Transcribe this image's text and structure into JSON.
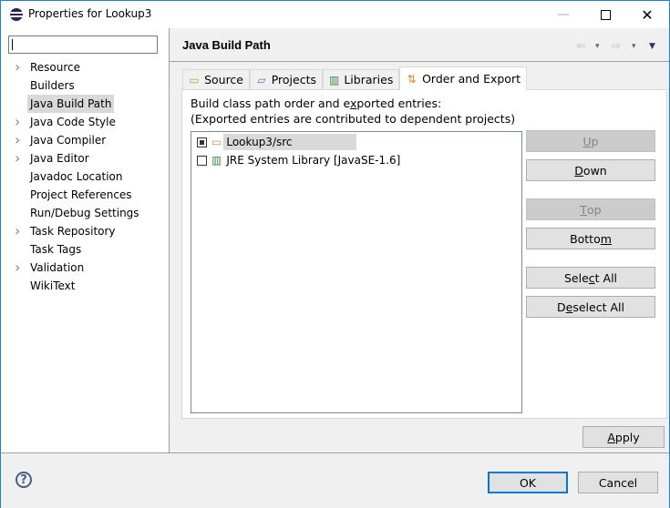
{
  "window": {
    "title": "Properties for Lookup3",
    "controls": {
      "minimize": "—",
      "close": "✕"
    }
  },
  "sidebar": {
    "filter_value": "",
    "items": [
      {
        "label": "Resource",
        "expandable": true,
        "selected": false
      },
      {
        "label": "Builders",
        "expandable": false,
        "selected": false
      },
      {
        "label": "Java Build Path",
        "expandable": false,
        "selected": true
      },
      {
        "label": "Java Code Style",
        "expandable": true,
        "selected": false
      },
      {
        "label": "Java Compiler",
        "expandable": true,
        "selected": false
      },
      {
        "label": "Java Editor",
        "expandable": true,
        "selected": false
      },
      {
        "label": "Javadoc Location",
        "expandable": false,
        "selected": false
      },
      {
        "label": "Project References",
        "expandable": false,
        "selected": false
      },
      {
        "label": "Run/Debug Settings",
        "expandable": false,
        "selected": false
      },
      {
        "label": "Task Repository",
        "expandable": true,
        "selected": false
      },
      {
        "label": "Task Tags",
        "expandable": false,
        "selected": false
      },
      {
        "label": "Validation",
        "expandable": true,
        "selected": false
      },
      {
        "label": "WikiText",
        "expandable": false,
        "selected": false
      }
    ]
  },
  "page": {
    "title": "Java Build Path",
    "nav": {
      "back": "⇦",
      "forward": "⇨",
      "dropdown": "▾",
      "menu": "▼"
    },
    "tabs": [
      {
        "label": "Source",
        "icon": "source-folder-icon",
        "active": false
      },
      {
        "label": "Projects",
        "icon": "folder-icon",
        "active": false
      },
      {
        "label": "Libraries",
        "icon": "libraries-icon",
        "active": false
      },
      {
        "label": "Order and Export",
        "icon": "order-export-icon",
        "active": true
      }
    ],
    "description": {
      "line1_pre": "Build class path order and e",
      "line1_u": "x",
      "line1_post": "ported entries:",
      "line2": "(Exported entries are contributed to dependent projects)"
    },
    "entries": [
      {
        "label": "Lookup3/src",
        "checked": true,
        "selected": true,
        "icon": "source-folder-icon"
      },
      {
        "label": "JRE System Library [JavaSE-1.6]",
        "checked": false,
        "selected": false,
        "icon": "library-icon"
      }
    ],
    "buttons": [
      {
        "id": "up",
        "pre": "",
        "u": "U",
        "post": "p",
        "enabled": false
      },
      {
        "id": "down",
        "pre": "",
        "u": "D",
        "post": "own",
        "enabled": true
      },
      {
        "id": "top",
        "pre": "",
        "u": "T",
        "post": "op",
        "enabled": false
      },
      {
        "id": "bottom",
        "pre": "Botto",
        "u": "m",
        "post": "",
        "enabled": true
      },
      {
        "id": "select-all",
        "pre": "Sele",
        "u": "c",
        "post": "t All",
        "enabled": true
      },
      {
        "id": "deselect-all",
        "pre": "D",
        "u": "e",
        "post": "select All",
        "enabled": true
      }
    ],
    "apply": {
      "pre": "",
      "u": "A",
      "post": "pply"
    }
  },
  "footer": {
    "help": "?",
    "ok": "OK",
    "cancel": "Cancel"
  }
}
